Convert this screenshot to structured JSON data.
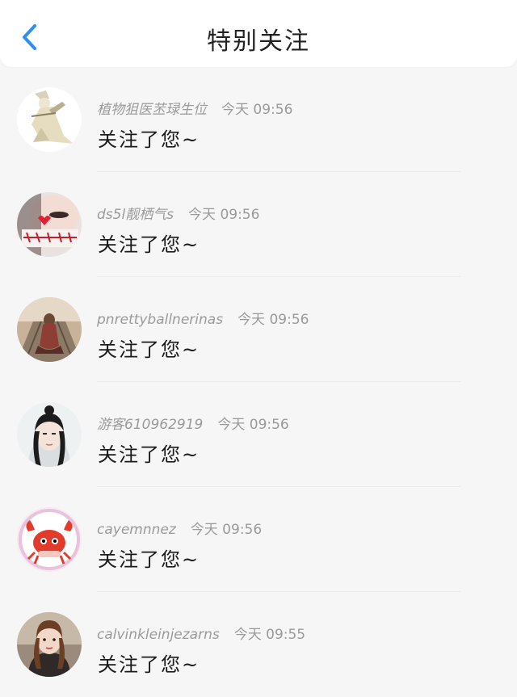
{
  "header": {
    "title": "特别关注",
    "back_icon": "chevron-left-icon",
    "accent_color": "#2f8ff0"
  },
  "notifications": [
    {
      "username": "植物狙医苤琭生位",
      "time": "今天 09:56",
      "message": "关注了您~",
      "avatar": "anime-swordsman"
    },
    {
      "username": "ds5l靓栖气s",
      "time": "今天 09:56",
      "message": "关注了您~",
      "avatar": "girl-love-you"
    },
    {
      "username": "pnrettyballnerinas",
      "time": "今天 09:56",
      "message": "关注了您~",
      "avatar": "girl-on-tracks"
    },
    {
      "username": "游客610962919",
      "time": "今天 09:56",
      "message": "关注了您~",
      "avatar": "ancient-costume-man"
    },
    {
      "username": "cayemnnez",
      "time": "今天 09:56",
      "message": "关注了您~",
      "avatar": "red-crab-cartoon"
    },
    {
      "username": "calvinkleinjezarns",
      "time": "今天 09:55",
      "message": "关注了您~",
      "avatar": "girl-selfie"
    }
  ]
}
